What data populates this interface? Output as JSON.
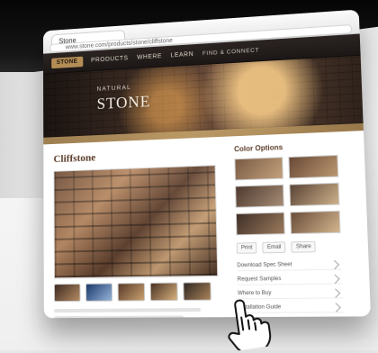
{
  "browser": {
    "tab_title": "Stone",
    "url_text": "www.stone.com/products/stone/cliffstone"
  },
  "site": {
    "brand": "STONE",
    "nav": [
      "PRODUCTS",
      "WHERE",
      "LEARN",
      "FIND & CONNECT"
    ],
    "hero_kicker": "Natural",
    "hero_title": "STONE",
    "page_heading": "Cliffstone"
  },
  "sidebar": {
    "title": "Color Options",
    "tools": [
      "Print",
      "Email",
      "Share"
    ],
    "links": [
      "Download Spec Sheet",
      "Request Samples",
      "Where to Buy",
      "Installation Guide"
    ]
  },
  "colors": {
    "brand_gold": "#b48d55",
    "nav_dark": "#1c1716",
    "heading_brown": "#5c3d2a"
  }
}
